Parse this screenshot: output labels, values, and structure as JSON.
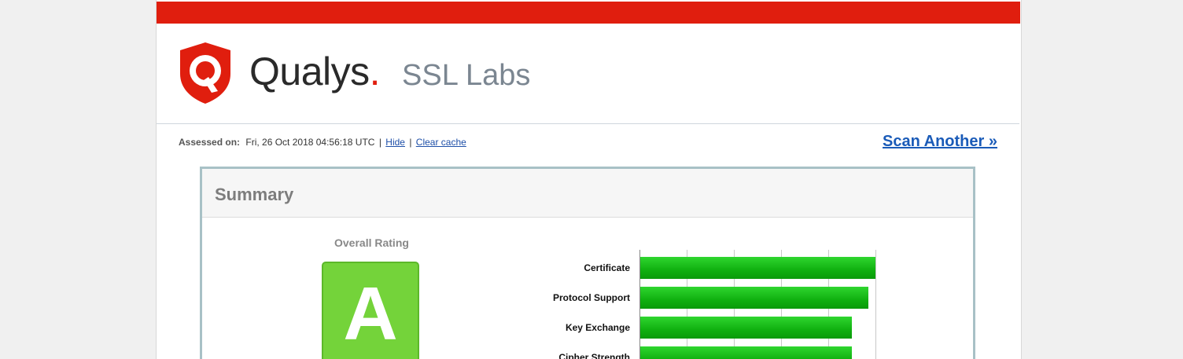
{
  "header": {
    "brand": "Qualys",
    "brand_dot": ".",
    "product": "SSL Labs"
  },
  "assessment": {
    "label": "Assessed on:",
    "timestamp": "Fri, 26 Oct 2018 04:56:18 UTC",
    "hide_link": "Hide",
    "clear_cache_link": "Clear cache",
    "separator": "|"
  },
  "scan_another": "Scan Another »",
  "summary": {
    "title": "Summary",
    "overall_label": "Overall Rating",
    "grade": "A",
    "grade_color": "#74d33a"
  },
  "chart_data": {
    "type": "bar",
    "orientation": "horizontal",
    "categories": [
      "Certificate",
      "Protocol Support",
      "Key Exchange",
      "Cipher Strength"
    ],
    "values": [
      100,
      97,
      90,
      90
    ],
    "xlim": [
      0,
      100
    ],
    "grid": true,
    "bar_color": "#10b010"
  },
  "colors": {
    "brand_red": "#e01e0e",
    "link_blue": "#1a5bb8",
    "panel_border": "#a8c1c6"
  }
}
